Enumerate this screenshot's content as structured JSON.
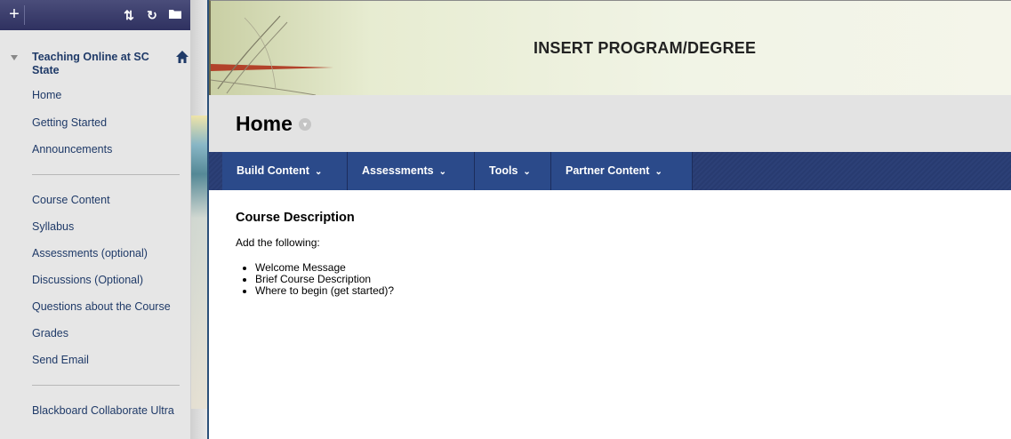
{
  "sidebar": {
    "toolbar": {
      "add": "+",
      "sort": "⇅",
      "refresh": "↻",
      "folder": "▭"
    },
    "course_title": "Teaching Online at SC State",
    "items": [
      "Home",
      "Getting Started",
      "Announcements",
      "Course Content",
      "Syllabus",
      "Assessments (optional)",
      "Discussions (Optional)",
      "Questions about the Course",
      "Grades",
      "Send Email",
      "Blackboard Collaborate Ultra"
    ]
  },
  "banner": {
    "title": "INSERT PROGRAM/DEGREE"
  },
  "page": {
    "title": "Home"
  },
  "action_bar": [
    "Build Content",
    "Assessments",
    "Tools",
    "Partner Content"
  ],
  "content": {
    "heading": "Course Description",
    "intro": "Add the following:",
    "items": [
      "Welcome Message",
      "Brief Course Description",
      "Where to begin (get started)?"
    ]
  },
  "colors": {
    "menu_text": "#1f3a68",
    "action_bar": "#2b4a8a",
    "toolbar": "#2f3160"
  }
}
